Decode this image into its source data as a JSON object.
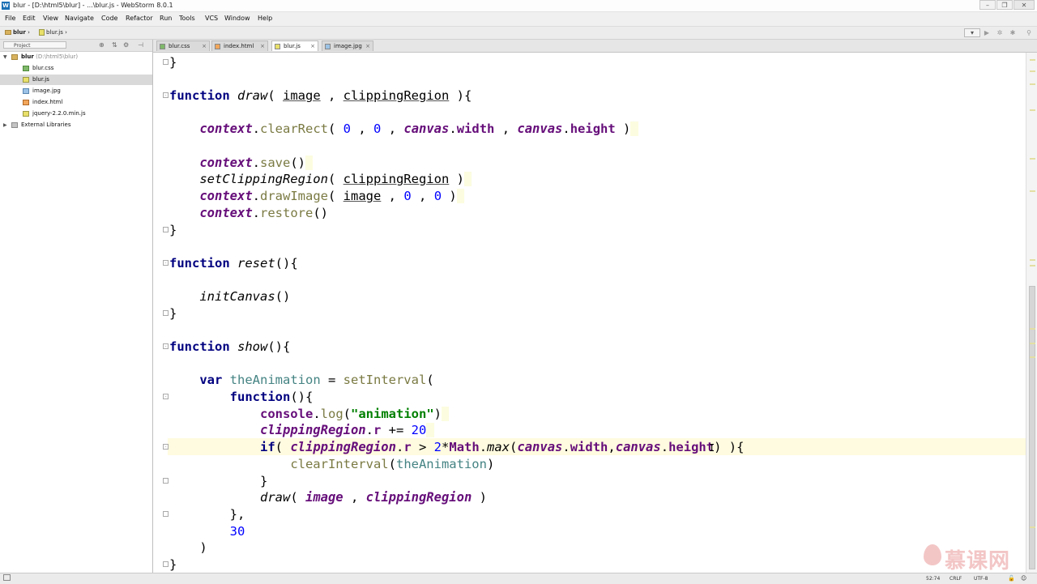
{
  "window": {
    "title": "blur - [D:\\html5\\blur] - ...\\blur.js - WebStorm 8.0.1",
    "buttons": [
      "–",
      "❐",
      "✕"
    ]
  },
  "menu": [
    "File",
    "Edit",
    "View",
    "Navigate",
    "Code",
    "Refactor",
    "Run",
    "Tools",
    "VCS",
    "Window",
    "Help"
  ],
  "breadcrumb": [
    "blur",
    "blur.js"
  ],
  "sidebar": {
    "selector": "Project",
    "tree": [
      {
        "label": "blur",
        "path": "(D:\\html5\\blur)",
        "type": "folder"
      },
      {
        "label": "blur.css",
        "type": "css"
      },
      {
        "label": "blur.js",
        "type": "js",
        "selected": true
      },
      {
        "label": "image.jpg",
        "type": "img"
      },
      {
        "label": "index.html",
        "type": "html"
      },
      {
        "label": "jquery-2.2.0.min.js",
        "type": "js"
      },
      {
        "label": "External Libraries",
        "type": "lib"
      }
    ]
  },
  "tabs": [
    {
      "label": "blur.css",
      "active": false
    },
    {
      "label": "index.html",
      "active": false
    },
    {
      "label": "blur.js",
      "active": true
    },
    {
      "label": "image.jpg",
      "active": false
    }
  ],
  "code": {
    "l1": "}",
    "l3_kw": "function",
    "l3_name": "draw",
    "l3_p1": "image",
    "l3_p2": "clippingRegion",
    "l5_ctx": "context",
    "l5_method": "clearRect",
    "l5_n1": "0",
    "l5_n2": "0",
    "l5_canvas": "canvas",
    "l5_width": "width",
    "l5_height": "height",
    "l7_ctx": "context",
    "l7_method": "save",
    "l8_fn": "setClippingRegion",
    "l8_arg": "clippingRegion",
    "l9_ctx": "context",
    "l9_method": "drawImage",
    "l9_arg": "image",
    "l9_n1": "0",
    "l9_n2": "0",
    "l10_ctx": "context",
    "l10_method": "restore",
    "l11": "}",
    "l13_kw": "function",
    "l13_name": "reset",
    "l15_call": "initCanvas",
    "l16": "}",
    "l18_kw": "function",
    "l18_name": "show",
    "l20_kw": "var",
    "l20_var": "theAnimation",
    "l20_fn": "setInterval",
    "l21_kw": "function",
    "l22_obj": "console",
    "l22_method": "log",
    "l22_str": "\"animation\"",
    "l23_obj": "clippingRegion",
    "l23_prop": "r",
    "l23_num": "20",
    "l24_kw": "if",
    "l24_obj": "clippingRegion",
    "l24_prop": "r",
    "l24_num": "2",
    "l24_math": "Math",
    "l24_max": "max",
    "l24_canvas1": "canvas",
    "l24_width": "width",
    "l24_canvas2": "canvas",
    "l24_height": "height",
    "l25_fn": "clearInterval",
    "l25_arg": "theAnimation",
    "l26": "}",
    "l27_fn": "draw",
    "l27_a1": "image",
    "l27_a2": "clippingRegion",
    "l28": "},",
    "l29_num": "30",
    "l30": ")",
    "l31": "}"
  },
  "status": {
    "position": "52:74",
    "line_sep": "CRLF",
    "encoding": "UTF-8"
  },
  "watermark": "慕课网"
}
